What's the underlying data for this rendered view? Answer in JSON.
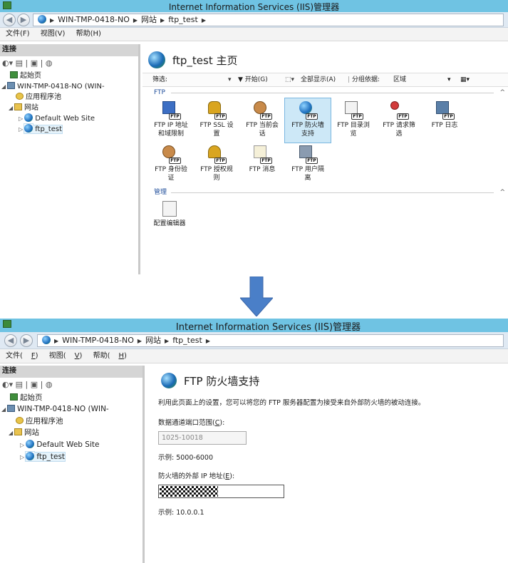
{
  "window_title": "Internet Information Services (IIS)管理器",
  "address": {
    "server": "WIN-TMP-0418-NO",
    "sites": "网站",
    "site": "ftp_test"
  },
  "menu": [
    "文件(F)",
    "视图(V)",
    "帮助(H)"
  ],
  "left": {
    "connections": "连接",
    "tree": {
      "start": "起始页",
      "server1": "WIN-TMP-0418-NO (WIN-",
      "server2": "WIN-TMP-0418-NO (WIN-",
      "pools": "应用程序池",
      "sites": "网站",
      "default_site": "Default Web Site",
      "ftp_test": "ftp_test"
    }
  },
  "home": {
    "title": "ftp_test 主页",
    "filter_label": "筛选:",
    "start": "▼ 开始(G)",
    "show_all": "全部显示(A)",
    "group_by": "分组依据:",
    "group_val": "区域",
    "group_ftp": "FTP",
    "group_mgmt": "管理",
    "icons": [
      {
        "l1": "FTP IP 地址",
        "l2": "和域限制"
      },
      {
        "l1": "FTP SSL 设",
        "l2": "置"
      },
      {
        "l1": "FTP 当前会",
        "l2": "话"
      },
      {
        "l1": "FTP 防火墙",
        "l2": "支持"
      },
      {
        "l1": "FTP 目录浏",
        "l2": "览"
      },
      {
        "l1": "FTP 请求筛",
        "l2": "选"
      },
      {
        "l1": "FTP 日志",
        "l2": ""
      },
      {
        "l1": "FTP 身份验",
        "l2": "证"
      },
      {
        "l1": "FTP 授权规",
        "l2": "则"
      },
      {
        "l1": "FTP 消息",
        "l2": ""
      },
      {
        "l1": "FTP 用户隔",
        "l2": "离"
      }
    ],
    "config_editor": "配置编辑器"
  },
  "fw": {
    "title": "FTP 防火墙支持",
    "desc": "利用此页面上的设置，您可以将您的 FTP 服务器配置为接受来自外部防火墙的被动连接。",
    "range_label": "数据通道端口范围(",
    "range_key": "C",
    "range_value": "1025-10018",
    "range_example": "示例: 5000-6000",
    "ip_label": "防火墙的外部 IP 地址(",
    "ip_key": "E",
    "ip_example": "示例: 10.0.0.1"
  },
  "menu2": {
    "file": "文件(",
    "file_k": "F",
    "view": "视图(",
    "view_k": "V",
    "help": "帮助(",
    "help_k": "H"
  }
}
